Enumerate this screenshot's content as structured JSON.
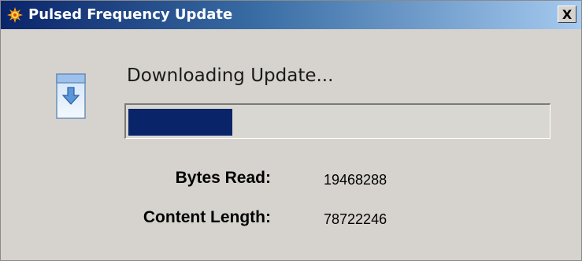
{
  "window": {
    "title": "Pulsed Frequency Update",
    "title_icon": "sun-gear-icon",
    "close_label": "X"
  },
  "main": {
    "icon": "download-arrow-icon",
    "heading": "Downloading Update...",
    "progress_fraction": 0.2473,
    "fields": {
      "bytes_read_label": "Bytes Read:",
      "bytes_read_value": "19468288",
      "content_length_label": "Content Length:",
      "content_length_value": "78722246"
    }
  },
  "colors": {
    "titlebar_start": "#0a246a",
    "titlebar_end": "#a6caf0",
    "progress_fill": "#0a246a",
    "window_bg": "#d6d3ce"
  }
}
